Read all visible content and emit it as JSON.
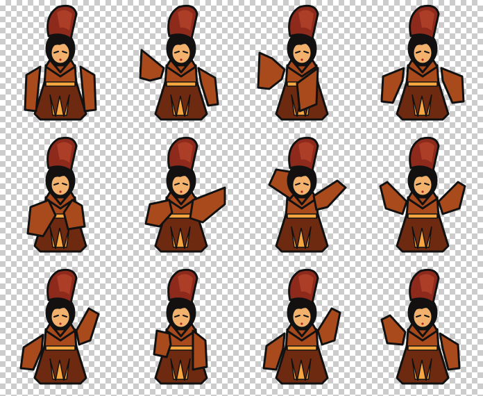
{
  "sprite_sheet": {
    "rows": 3,
    "columns": 4,
    "colors": {
      "hat": "#8e2a1c",
      "hat_light": "#b9472c",
      "hair": "#141010",
      "skin": "#f2b26e",
      "robe": "#a84a1c",
      "robe_dark": "#6e2a10",
      "trim": "#f5a640",
      "outline": "#111111"
    },
    "frames": [
      {
        "pose": "arms-down"
      },
      {
        "pose": "left-arm-raised"
      },
      {
        "pose": "left-arm-up-sleeve"
      },
      {
        "pose": "arms-out"
      },
      {
        "pose": "sleeves-crossed"
      },
      {
        "pose": "sleeves-folded"
      },
      {
        "pose": "arm-over-head"
      },
      {
        "pose": "arms-spread-high"
      },
      {
        "pose": "right-arm-raised"
      },
      {
        "pose": "turned-side"
      },
      {
        "pose": "right-arm-up"
      },
      {
        "pose": "right-arm-up-alt"
      }
    ]
  }
}
